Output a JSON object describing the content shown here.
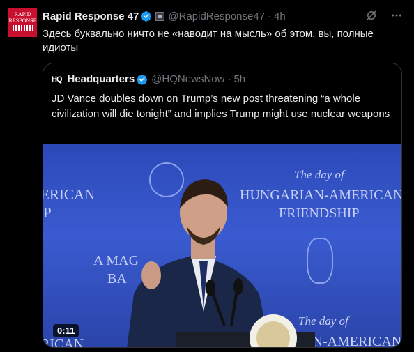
{
  "post": {
    "avatar_text_1": "RAPID",
    "avatar_text_2": "RESPONSE",
    "author_name": "Rapid Response 47",
    "handle": "@RapidResponse47",
    "separator": "·",
    "time": "4h",
    "text": "Здесь буквально ничто  не «наводит на мысль» об этом, вы, полные идиоты",
    "icons": {
      "grok": "grok-icon",
      "more": "more-icon",
      "verified": "verified-badge-icon"
    }
  },
  "quote": {
    "logo": "HQ",
    "author_name": "Headquarters",
    "handle": "@HQNewsNow",
    "separator": "·",
    "time": "5h",
    "text": "JD Vance doubles down on Trump’s new post threatening “a whole civilization will die tonight” and implies Trump might use nuclear weapons",
    "video": {
      "duration": "0:11",
      "backdrop_text": {
        "left_1": "ERICAN",
        "left_2": "P",
        "left_3": "A MAG",
        "left_4": "BA",
        "left_5": "RICAN",
        "script_1": "The day of",
        "right_1": "HUNGARIAN-AMERICAN",
        "right_2": "FRIENDSHIP",
        "script_2": "The day of",
        "right_3": "AN-AMERICAN"
      }
    }
  },
  "colors": {
    "background": "#000000",
    "text": "#e7e9ea",
    "muted": "#71767b",
    "verified": "#1d9bf0",
    "border": "#2f3336",
    "video_blue": "#3a5bd0"
  }
}
